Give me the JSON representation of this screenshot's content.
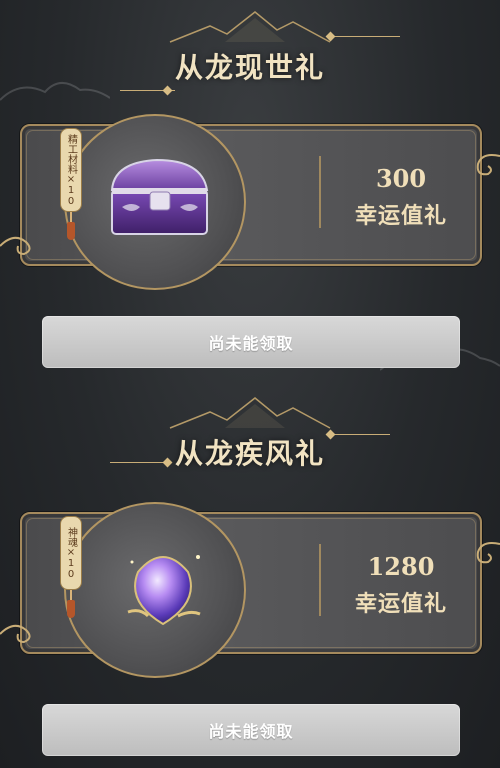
{
  "sections": [
    {
      "title": "从龙现世礼",
      "reward_tag": "精工材料×10",
      "reward_icon": "purple-treasure-chest-icon",
      "value": "300",
      "value_label": "幸运值礼",
      "button_label": "尚未能领取"
    },
    {
      "title": "从龙疾风礼",
      "reward_tag": "神魂×10",
      "reward_icon": "purple-spirit-gem-icon",
      "value": "1280",
      "value_label": "幸运值礼",
      "button_label": "尚未能领取"
    }
  ],
  "colors": {
    "gold": "#c9ad77",
    "title_text": "#f1e3c2",
    "button_bg": "#c9c9c9",
    "card_bg": "#505052"
  }
}
